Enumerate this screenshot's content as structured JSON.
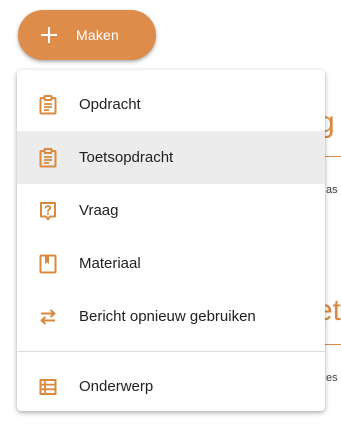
{
  "create_button": {
    "label": "Maken",
    "icon": "plus-icon"
  },
  "menu": {
    "items": [
      {
        "label": "Opdracht",
        "icon": "assignment-icon"
      },
      {
        "label": "Toetsopdracht",
        "icon": "quiz-assignment-icon"
      },
      {
        "label": "Vraag",
        "icon": "question-icon"
      },
      {
        "label": "Materiaal",
        "icon": "material-icon"
      },
      {
        "label": "Bericht opnieuw gebruiken",
        "icon": "reuse-post-icon"
      }
    ],
    "topic_item": {
      "label": "Onderwerp",
      "icon": "topic-icon"
    }
  },
  "background": {
    "heading_1": "g",
    "snippet_1": "as",
    "heading_2": "et",
    "snippet_2": "es"
  },
  "colors": {
    "accent": "#de8c4a",
    "icon": "#d98a3e",
    "hover": "#ececec"
  }
}
